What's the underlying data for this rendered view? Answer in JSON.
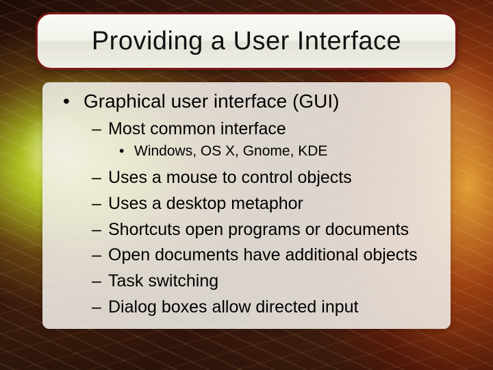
{
  "title": "Providing a User Interface",
  "bullets": {
    "lvl1": {
      "marker": "•",
      "text": "Graphical user interface (GUI)"
    },
    "lvl2_first": {
      "marker": "–",
      "text": "Most common interface"
    },
    "lvl3": {
      "marker": "•",
      "text": "Windows, OS X, Gnome, KDE"
    },
    "lvl2_rest": [
      {
        "marker": "–",
        "text": "Uses a mouse to control objects"
      },
      {
        "marker": "–",
        "text": "Uses a desktop metaphor"
      },
      {
        "marker": "–",
        "text": "Shortcuts open programs or documents"
      },
      {
        "marker": "–",
        "text": "Open documents have additional objects"
      },
      {
        "marker": "–",
        "text": "Task switching"
      },
      {
        "marker": "–",
        "text": "Dialog boxes allow directed input"
      }
    ]
  }
}
